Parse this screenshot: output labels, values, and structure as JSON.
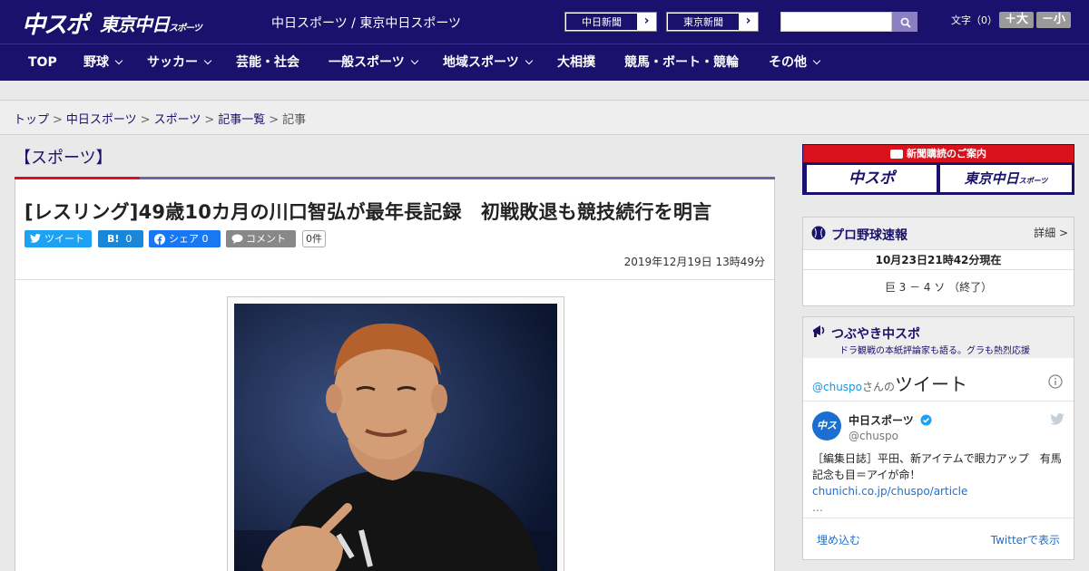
{
  "header": {
    "logo_main": "中スポ",
    "logo_sub": "東京中日",
    "logo_sub_small": "スポーツ",
    "site_name": "中日スポーツ / 東京中日スポーツ",
    "paper_links": [
      "中日新聞",
      "東京新聞"
    ],
    "search_placeholder": "",
    "font_label": "文字（0）",
    "font_larger": "＋大",
    "font_smaller": "－小"
  },
  "nav": {
    "items": [
      {
        "label": "TOP",
        "dropdown": false
      },
      {
        "label": "野球",
        "dropdown": true
      },
      {
        "label": "サッカー",
        "dropdown": true
      },
      {
        "label": "芸能・社会",
        "dropdown": false
      },
      {
        "label": "一般スポーツ",
        "dropdown": true
      },
      {
        "label": "地域スポーツ",
        "dropdown": true
      },
      {
        "label": "大相撲",
        "dropdown": false
      },
      {
        "label": "競馬・ボート・競輪",
        "dropdown": false
      },
      {
        "label": "その他",
        "dropdown": true
      }
    ]
  },
  "breadcrumb": {
    "items": [
      "トップ",
      "中日スポーツ",
      "スポーツ",
      "記事一覧"
    ],
    "current": "記事",
    "separator": ">"
  },
  "article": {
    "section": "【スポーツ】",
    "headline": "[レスリング]49歳10カ月の川口智弘が最年長記録　初戦敗退も競技続行を明言",
    "share": {
      "tweet": "ツイート",
      "hatena": "B!",
      "hatena_count": "0",
      "facebook": "シェア",
      "facebook_count": "0",
      "comment": "コメント",
      "comment_count": "0件"
    },
    "date": "2019年12月19日 13時49分"
  },
  "sidebar": {
    "subscription": {
      "title": "新聞購読のご案内",
      "logo_left": "中スポ",
      "logo_right": "東京中日",
      "logo_right_small": "スポーツ"
    },
    "baseball": {
      "title": "プロ野球速報",
      "more": "詳細 >",
      "timestamp": "10月23日21時42分現在",
      "score": "巨 3 － 4 ソ （終了）"
    },
    "twitter": {
      "title": "つぶやき中スポ",
      "subtitle": "ドラ観戦の本紙評論家も語る。グラも熱烈応援",
      "handle_link": "@chuspo",
      "handle_suffix": "さんの",
      "tweets_label": "ツイート",
      "account_name": "中日スポーツ",
      "account_handle": "@chuspo",
      "tweet_text": "［編集日誌］平田、新アイテムで眼力アップ　有馬記念も目＝アイが命！",
      "tweet_link": "chunichi.co.jp/chuspo/article",
      "tweet_ellipsis": "…",
      "embed": "埋め込む",
      "view_on": "Twitterで表示"
    }
  },
  "colors": {
    "brand_navy": "#19116b",
    "accent_red": "#d8111c",
    "twitter_blue": "#1da1f2",
    "facebook_blue": "#1877f2"
  }
}
